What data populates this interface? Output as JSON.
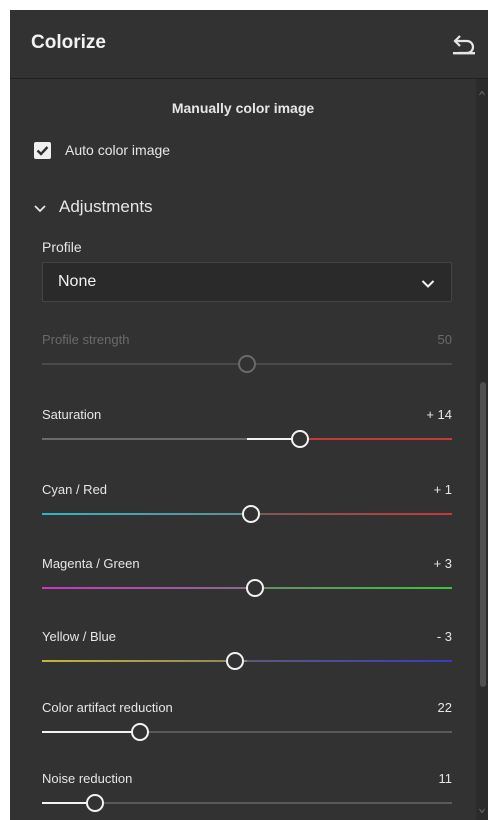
{
  "header": {
    "title": "Colorize",
    "reset_icon": "undo-arrow-icon"
  },
  "manual_label": "Manually color image",
  "auto_color": {
    "label": "Auto color image",
    "checked": true
  },
  "adjustments": {
    "label": "Adjustments",
    "expanded": true
  },
  "profile": {
    "label": "Profile",
    "value": "None"
  },
  "sliders": [
    {
      "label": "Profile strength",
      "value": "50",
      "position": 0.5,
      "disabled": true
    },
    {
      "label": "Saturation",
      "value": "+ 14",
      "position": 0.63,
      "disabled": false
    },
    {
      "label": "Cyan / Red",
      "value": "+ 1",
      "position": 0.51,
      "disabled": false
    },
    {
      "label": "Magenta / Green",
      "value": "+ 3",
      "position": 0.52,
      "disabled": false
    },
    {
      "label": "Yellow / Blue",
      "value": "- 3",
      "position": 0.47,
      "disabled": false
    },
    {
      "label": "Color artifact reduction",
      "value": "22",
      "position": 0.24,
      "disabled": false
    },
    {
      "label": "Noise reduction",
      "value": "11",
      "position": 0.13,
      "disabled": false
    }
  ],
  "colors": {
    "panel_bg": "#323232",
    "text": "#e6e6e6",
    "cyan": "#2fb6c3",
    "red": "#c43a3a",
    "magenta": "#c43ac0",
    "green": "#3ac43a",
    "yellow": "#c4b43a",
    "blue": "#3a3ac4"
  }
}
